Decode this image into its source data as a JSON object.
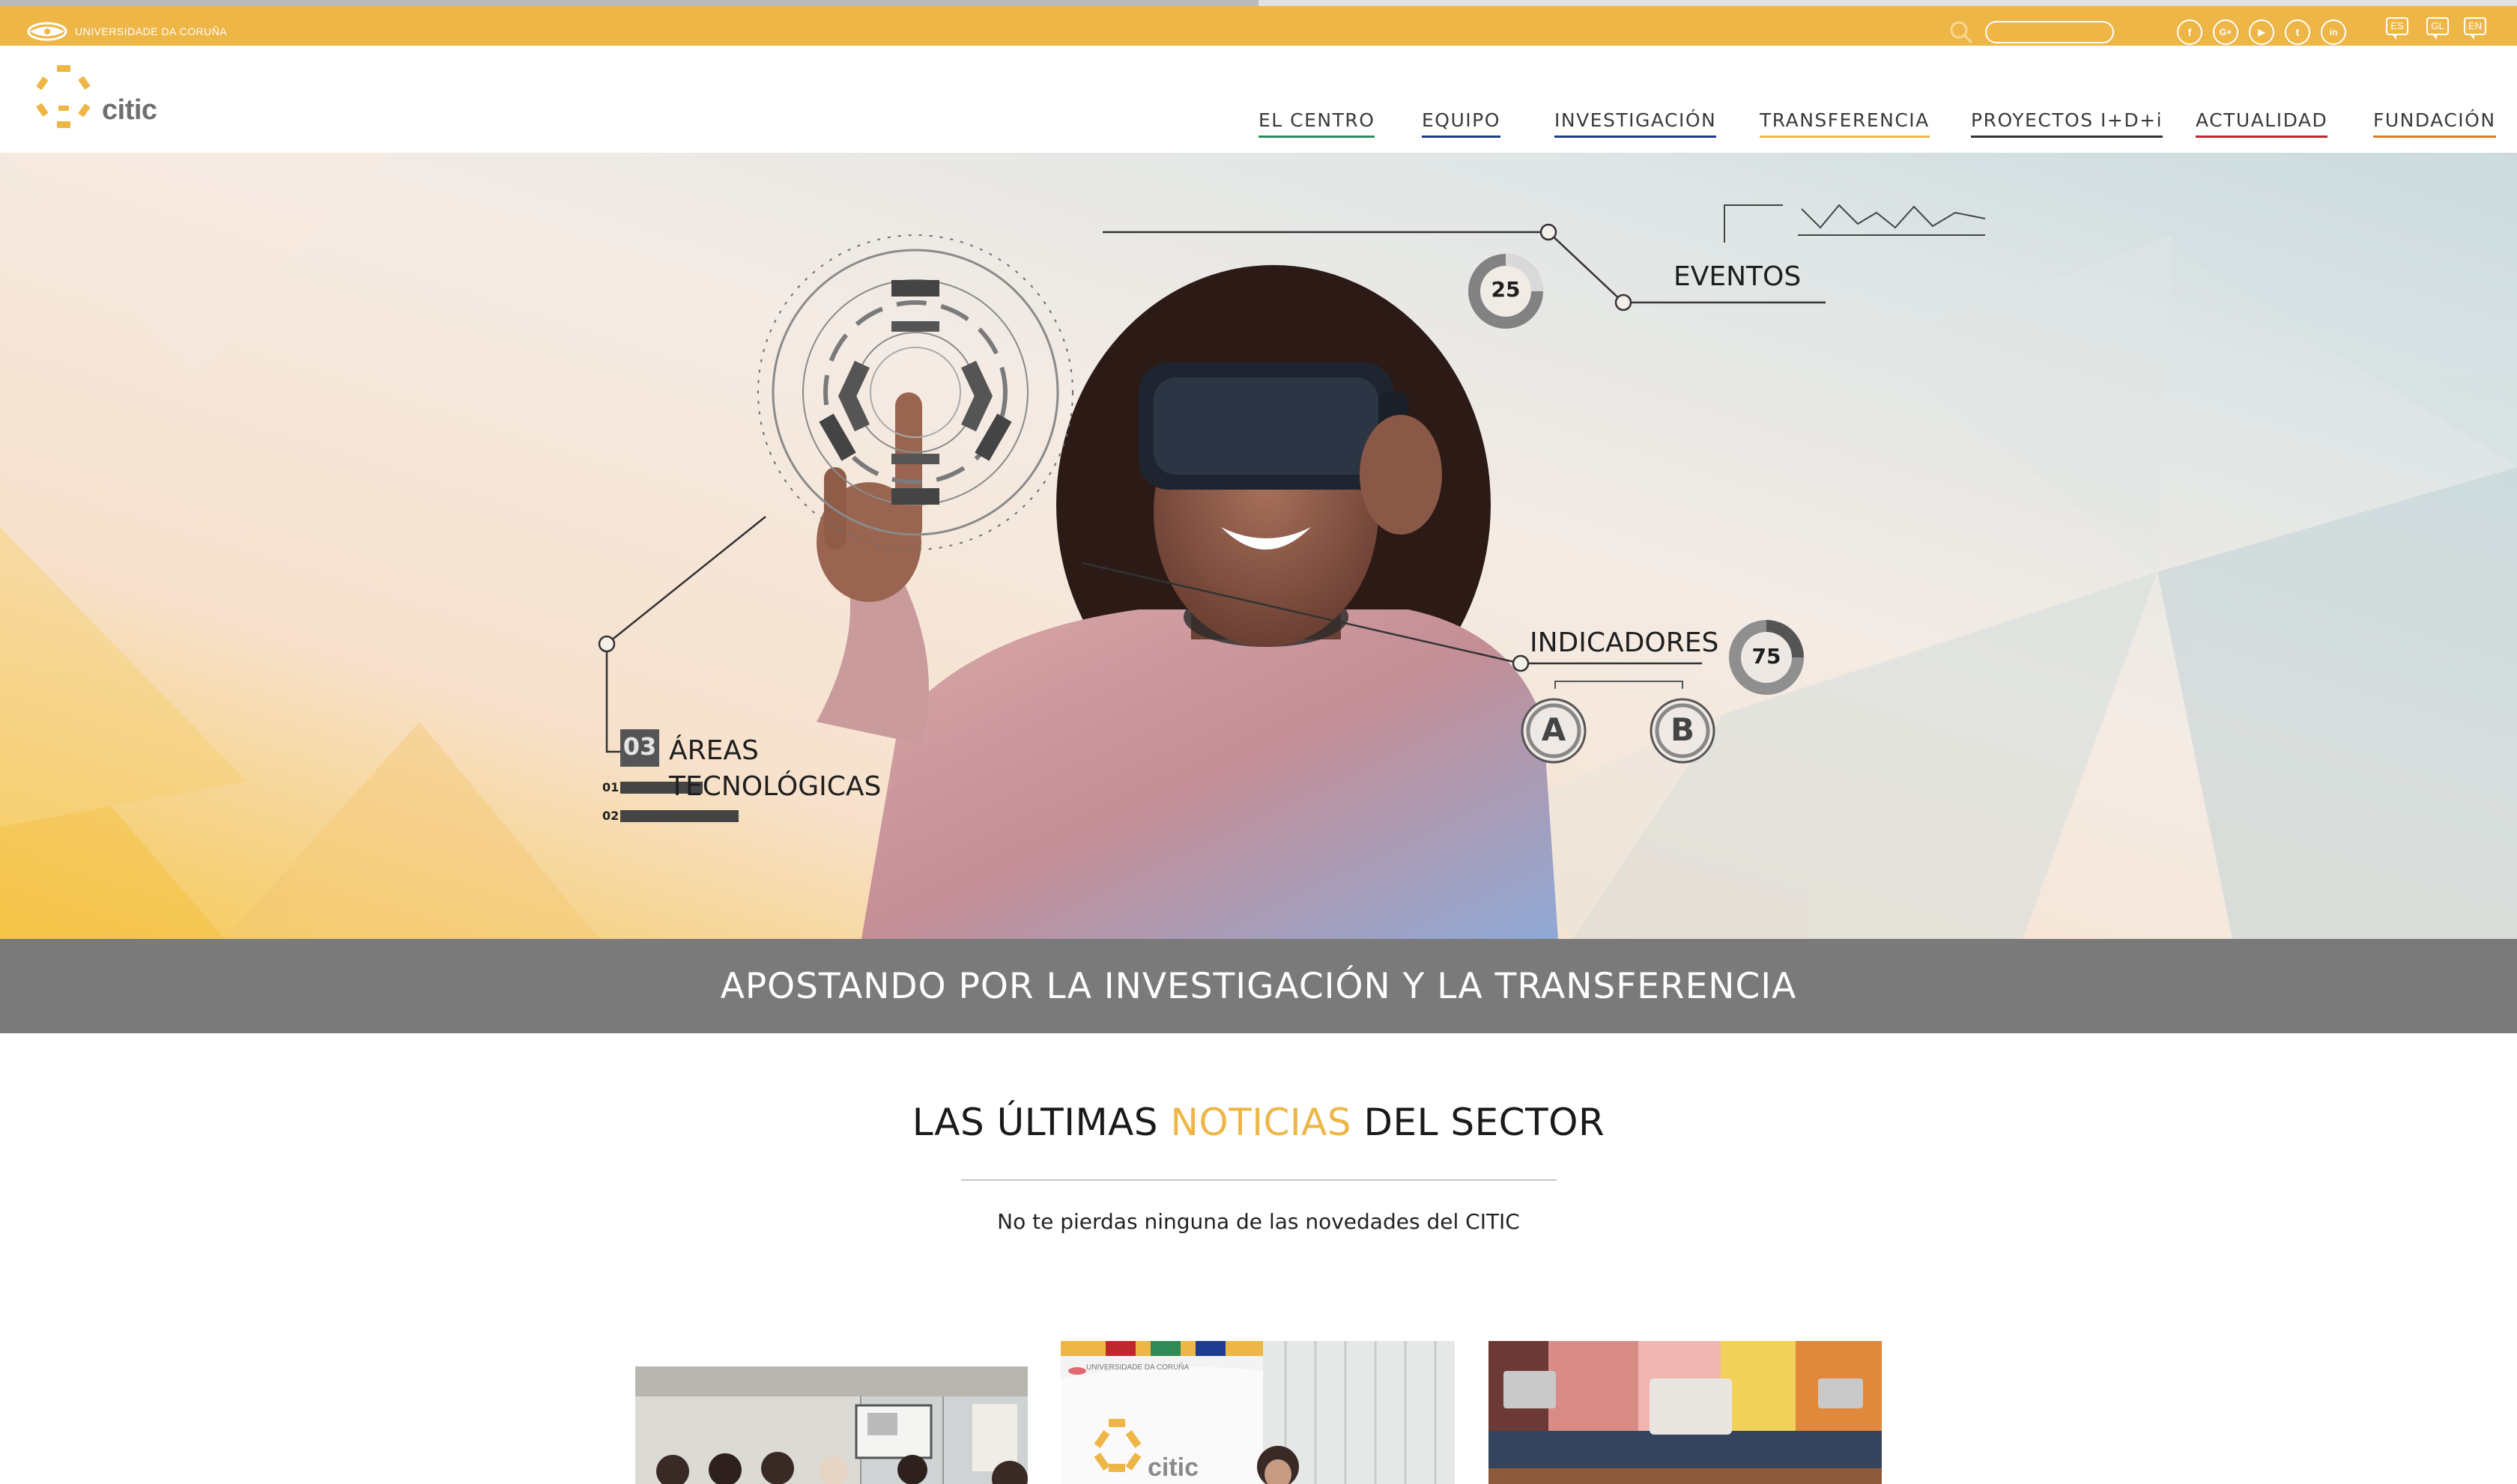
{
  "topbar": {
    "university_name": "UNIVERSIDADE DA CORUÑA",
    "search_placeholder": "",
    "social": [
      "f",
      "G+",
      "▶",
      "t",
      "in"
    ],
    "languages": [
      "ES",
      "GL",
      "EN"
    ]
  },
  "header": {
    "logo_text": "citic",
    "nav": [
      {
        "label": "EL CENTRO",
        "color": "#2e8b57"
      },
      {
        "label": "EQUIPO",
        "color": "#1d3c8f"
      },
      {
        "label": "INVESTIGACIÓN",
        "color": "#1d3c8f"
      },
      {
        "label": "TRANSFERENCIA",
        "color": "#eeb646"
      },
      {
        "label": "PROYECTOS I+D+i",
        "color": "#333333"
      },
      {
        "label": "ACTUALIDAD",
        "color": "#c0262d"
      },
      {
        "label": "FUNDACIÓN",
        "color": "#e07a1f"
      }
    ]
  },
  "hero": {
    "eventos_label": "EVENTOS",
    "eventos_count": "25",
    "indicadores_label": "INDICADORES",
    "indicadores_count": "75",
    "indicador_a": "A",
    "indicador_b": "B",
    "areas_count": "03",
    "areas_line1": "ÁREAS",
    "areas_line2": "TECNOLÓGICAS",
    "areas_row1": "01",
    "areas_row2": "02"
  },
  "banner": {
    "part1": "APOSTANDO POR LA ",
    "part2": "INVESTIGACIÓN",
    "part3": " Y LA ",
    "part4": "TRANSFERENCIA"
  },
  "news": {
    "title_part1": "LAS ÚLTIMAS ",
    "title_highlight": "NOTICIAS",
    "title_part2": " DEL SECTOR",
    "subtitle": "No te pierdas ninguna de las novedades del CITIC",
    "card2_logo_university": "UNIVERSIDADE DA CORUÑA",
    "card2_logo_text": "citic"
  },
  "colors": {
    "accent": "#eeb646",
    "banner": "#7a7a7a"
  }
}
